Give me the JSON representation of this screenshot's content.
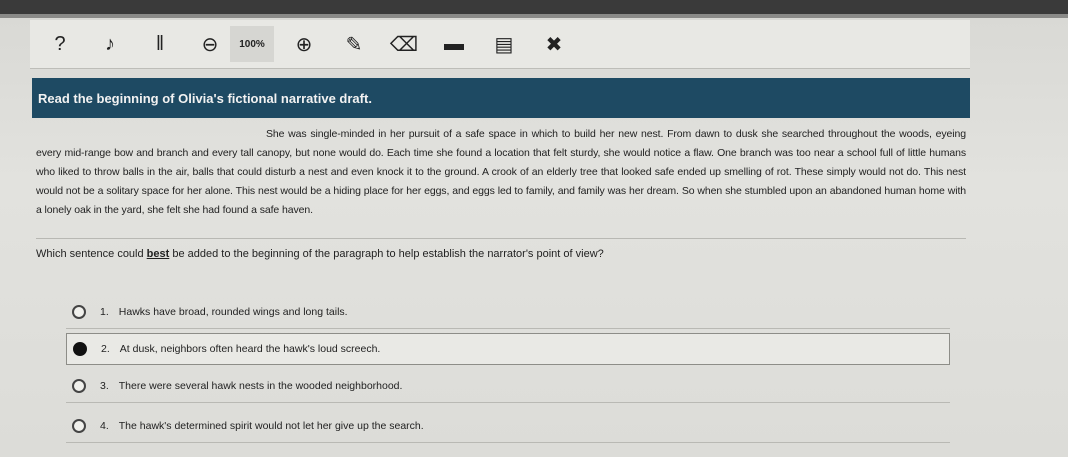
{
  "toolbar": {
    "items": [
      {
        "icon": "question-icon",
        "glyph": "?"
      },
      {
        "icon": "text-to-speech-icon",
        "glyph": "♪"
      },
      {
        "icon": "pause-icon",
        "glyph": "‖"
      },
      {
        "icon": "zoom-out-icon",
        "glyph": "⊖"
      },
      {
        "icon": "zoom-level",
        "glyph": "100%"
      },
      {
        "icon": "zoom-in-icon",
        "glyph": "⊕"
      },
      {
        "icon": "pencil-icon",
        "glyph": "✎"
      },
      {
        "icon": "eraser-icon",
        "glyph": "⌫"
      },
      {
        "icon": "line-reader-icon",
        "glyph": "▬"
      },
      {
        "icon": "answer-masking-icon",
        "glyph": "▤"
      },
      {
        "icon": "strikethrough-icon",
        "glyph": "✖"
      }
    ]
  },
  "header": {
    "title": "Read the beginning of Olivia's fictional narrative draft."
  },
  "passage": {
    "text": "She was single-minded in her pursuit of a safe space in which to build her new nest. From dawn to dusk she searched throughout the woods, eyeing every mid-range bow and branch and every tall canopy, but none would do. Each time she found a location that felt sturdy, she would notice a flaw. One branch was too near a school full of little humans who liked to throw balls in the air, balls that could disturb a nest and even knock it to the ground. A crook of an elderly tree that looked safe ended up smelling of rot. These simply would not do. This nest would not be a solitary space for her alone. This nest would be a hiding place for her eggs, and eggs led to family, and family was her dream. So when she stumbled upon an abandoned human home with a lonely oak in the yard, she felt she had found a safe haven."
  },
  "question": {
    "prefix": "Which sentence could ",
    "emphasis": "best",
    "suffix": " be added to the beginning of the paragraph to help establish the narrator's point of view?"
  },
  "options": [
    {
      "number": "1.",
      "text": "Hawks have broad, rounded wings and long tails."
    },
    {
      "number": "2.",
      "text": "At dusk, neighbors often heard the hawk's loud screech."
    },
    {
      "number": "3.",
      "text": "There were several hawk nests in the wooded neighborhood."
    },
    {
      "number": "4.",
      "text": "The hawk's determined spirit would not let her give up the search."
    }
  ],
  "selected_option": "2.",
  "colors": {
    "header_bg": "#1e4a63",
    "header_text": "#f2f2f2"
  }
}
